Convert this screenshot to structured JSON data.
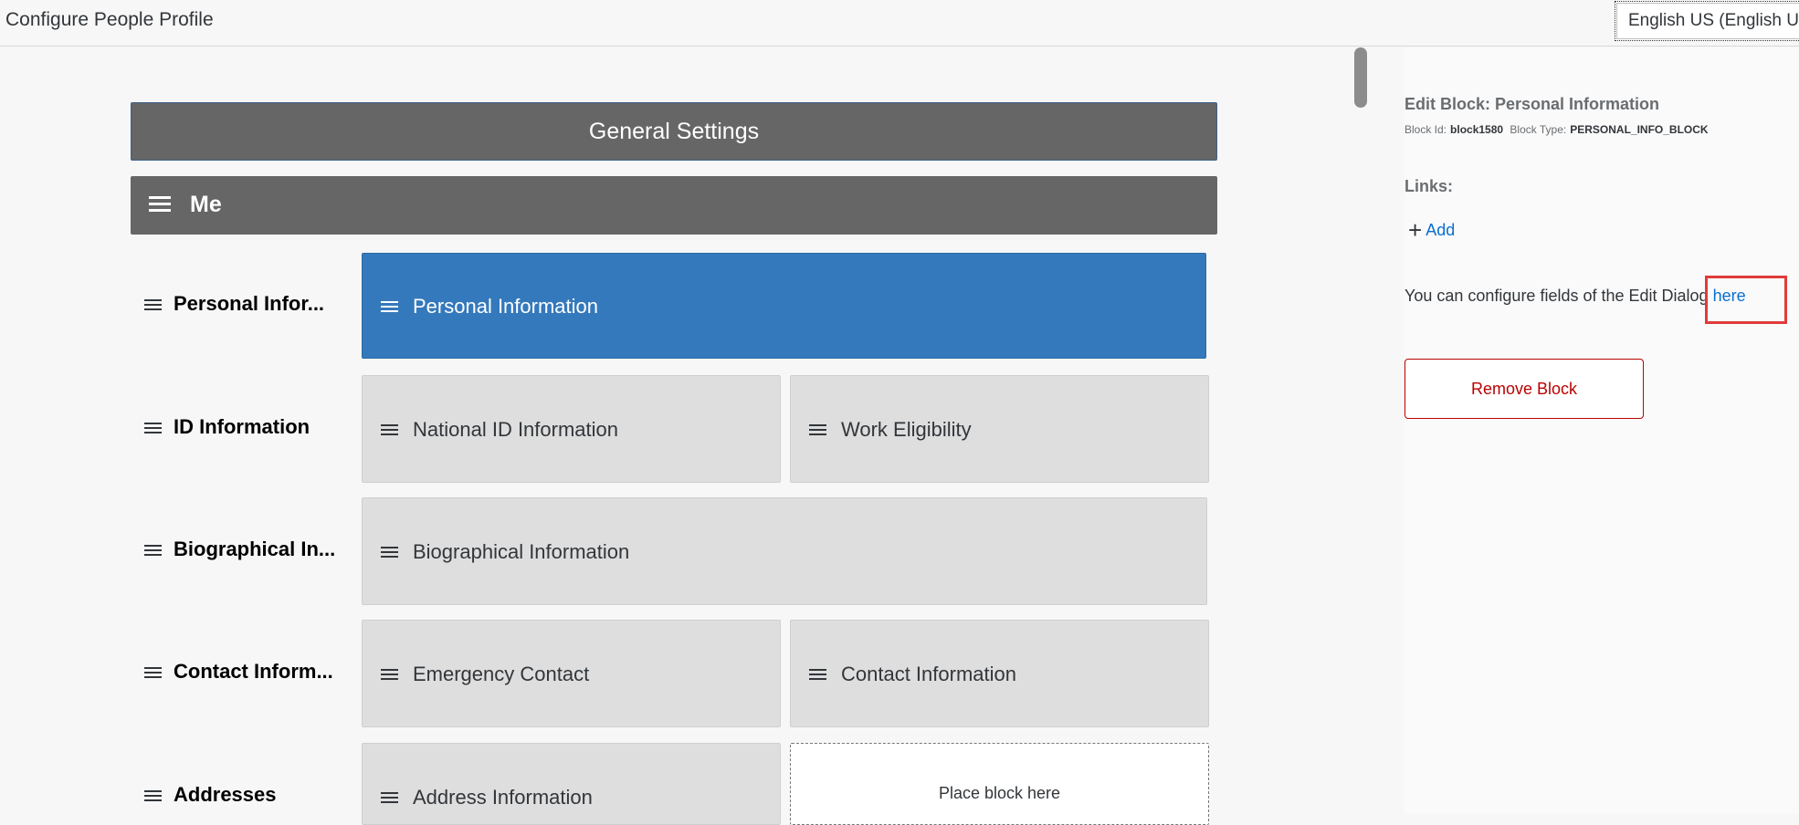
{
  "header": {
    "title": "Configure People Profile",
    "language": "English US (English US)"
  },
  "sections": {
    "general_settings": "General Settings",
    "me": "Me"
  },
  "rows": [
    {
      "label": "Personal Infor...",
      "blocks": [
        "Personal Information"
      ]
    },
    {
      "label": "ID Information",
      "blocks": [
        "National ID Information",
        "Work Eligibility"
      ]
    },
    {
      "label": "Biographical In...",
      "blocks": [
        "Biographical Information"
      ]
    },
    {
      "label": "Contact Inform...",
      "blocks": [
        "Emergency Contact",
        "Contact Information"
      ]
    },
    {
      "label": "Addresses",
      "blocks": [
        "Address Information"
      ],
      "placeholder": "Place block here"
    }
  ],
  "side_panel": {
    "title": "Edit Block: Personal Information",
    "block_id_label": "Block Id:",
    "block_id": "block1580",
    "block_type_label": "Block Type:",
    "block_type": "PERSONAL_INFO_BLOCK",
    "links_title": "Links:",
    "add_label": "Add",
    "config_text": "You can configure fields of the Edit Dialog",
    "here_link": "here",
    "remove_button": "Remove Block"
  },
  "colors": {
    "selected_block": "#3479bc",
    "section_bar": "#666666",
    "link": "#0a6ed1",
    "danger": "#bb0000",
    "highlight": "#e03b3b"
  }
}
